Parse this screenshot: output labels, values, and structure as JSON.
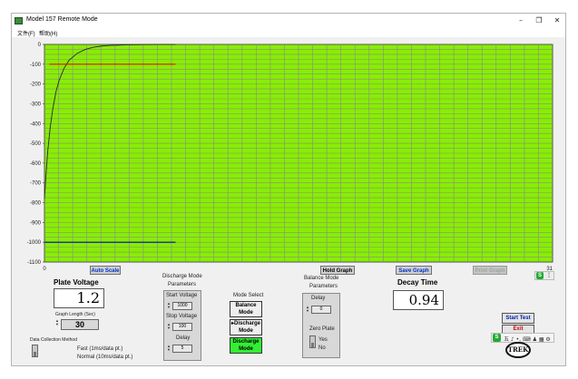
{
  "window": {
    "title": "Model 157 Remote Mode",
    "minimize": "–",
    "restore": "❐",
    "close": "✕"
  },
  "menu": [
    "文件(F)",
    "帮助(H)"
  ],
  "chart_data": {
    "type": "line",
    "xlabel": "",
    "ylabel": "",
    "x_ticks": [
      "0",
      "31"
    ],
    "ylim": [
      -1100,
      0
    ],
    "y_ticks": [
      0,
      -100,
      -200,
      -300,
      -400,
      -500,
      -600,
      -700,
      -800,
      -900,
      -1000,
      -1100
    ],
    "grid": true,
    "background": "#88ee00",
    "series": [
      {
        "color": "#2a2a2a",
        "x": [
          0,
          0.1,
          0.2,
          0.35,
          0.5,
          0.7,
          0.9,
          1.2,
          1.5,
          2.0,
          2.5,
          3.0,
          3.5,
          4.0,
          5.0,
          6.0,
          7.0,
          8.0
        ],
        "values": [
          -780,
          -650,
          -540,
          -420,
          -330,
          -240,
          -180,
          -120,
          -80,
          -45,
          -25,
          -14,
          -8,
          -5,
          -2,
          -1,
          0,
          0
        ]
      },
      {
        "color": "#ee1100",
        "x": [
          0.3,
          8.0
        ],
        "values": [
          -100,
          -100
        ]
      },
      {
        "color": "#0000cc",
        "x": [
          0,
          8.0
        ],
        "values": [
          -1000,
          -1000
        ]
      }
    ]
  },
  "graph_buttons": {
    "auto_scale": "Auto Scale",
    "hold_graph": "Hold Graph",
    "save_graph": "Save Graph",
    "disabled_button": "Print Graph"
  },
  "plate_voltage": {
    "label": "Plate Voltage",
    "value": "1.2"
  },
  "graph_length": {
    "label": "Graph Length (Sec)",
    "value": "30"
  },
  "data_collection": {
    "label": "Data Collection Method",
    "fast": "Fast (1ms/data pt.)",
    "normal": "Normal (10ms/data pt.)"
  },
  "discharge_params": {
    "title1": "Discharge Mode",
    "title2": "Parameters",
    "start_label": "Start Voltage",
    "start_value": "1000",
    "stop_label": "Stop Voltage",
    "stop_value": "100",
    "delay_label": "Delay",
    "delay_value": "5"
  },
  "mode_select": {
    "label": "Mode Select",
    "balance_l1": "Balance",
    "balance_l2": "Mode",
    "discharge_l1": "Discharge",
    "discharge_l2": "Mode",
    "discharge2_l1": "Discharge",
    "discharge2_l2": "Mode",
    "active_color": "#33ee33"
  },
  "balance_params": {
    "title1": "Balance Mode",
    "title2": "Parameters",
    "delay_label": "Delay",
    "delay_value": "0",
    "zero_plate_label": "Zero Plate",
    "yes_label": "Yes",
    "no_label": "No"
  },
  "decay_time": {
    "label": "Decay Time",
    "value": "0.94"
  },
  "test_controls": {
    "start_test": "Start Test",
    "exit": "Exit",
    "logo": "TREK"
  },
  "tray": {
    "icon_s": "S",
    "chars": "五 ♪ •, ⌨ ♟ ▦ ⚙"
  }
}
